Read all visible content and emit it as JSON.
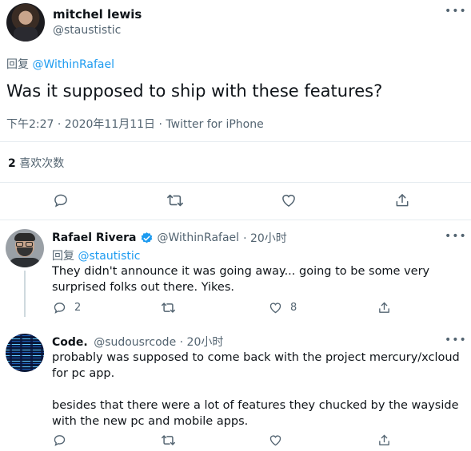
{
  "main_tweet": {
    "author_name": "mitchel lewis",
    "author_handle": "@staustistic",
    "reply_prefix": "回复",
    "reply_to": "@WithinRafael",
    "text": "Was it supposed to ship with these features?",
    "timestamp": "下午2:27 · 2020年11月11日",
    "source_sep": " · ",
    "source": "Twitter for iPhone",
    "likes_count": "2",
    "likes_label": "喜欢次数"
  },
  "replies": [
    {
      "author_name": "Rafael Rivera",
      "verified": true,
      "author_handle": "@WithinRafael",
      "time": "· 20小时",
      "reply_prefix": "回复",
      "reply_to": "@stautistic",
      "text": "They didn't announce it was going away... going to be some very surprised folks out there. Yikes.",
      "reply_count": "2",
      "retweet_count": "",
      "like_count": "8"
    },
    {
      "author_name": "Code.",
      "author_handle": "@sudousrcode",
      "time": "· 20小时",
      "text_p1": "probably was supposed to come back with the project mercury/xcloud for pc app.",
      "text_p2": "besides that there were a lot of features they chucked by the wayside with the new pc and mobile apps."
    }
  ],
  "icons": [
    "reply-icon",
    "retweet-icon",
    "like-icon",
    "share-icon",
    "more-icon",
    "verified-icon"
  ],
  "colors": {
    "accent": "#1d9bf0",
    "muted": "#536471",
    "text": "#0f1419",
    "divider": "#e6ecf0"
  }
}
